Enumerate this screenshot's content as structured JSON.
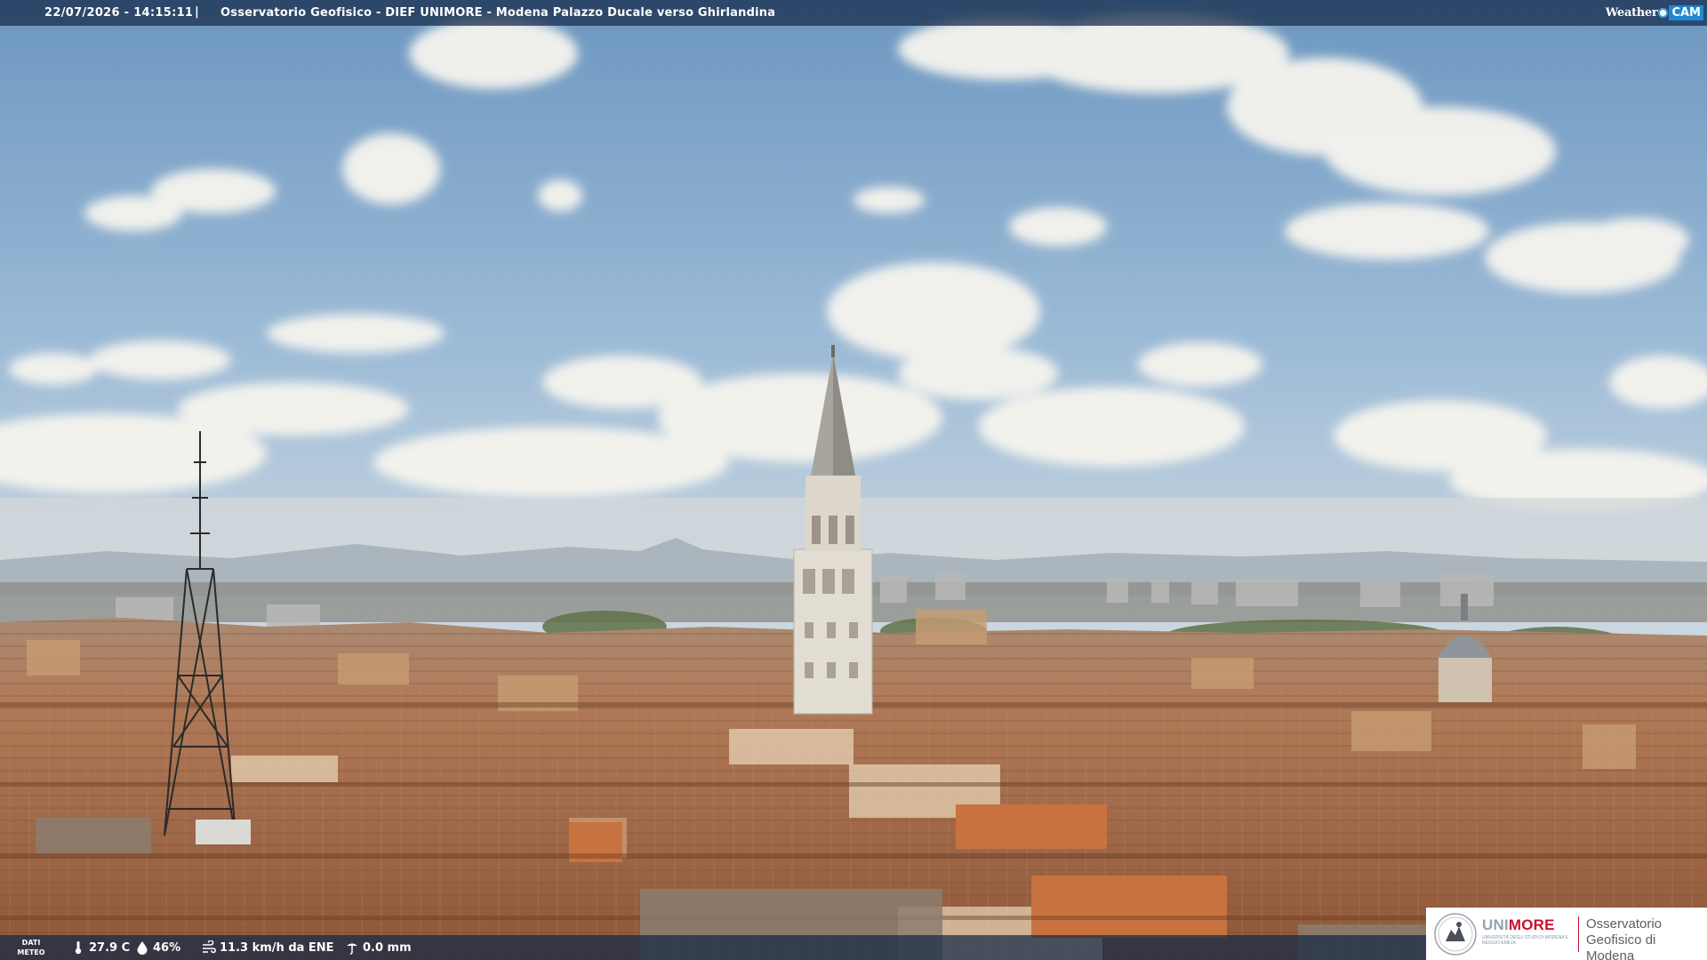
{
  "top_bar": {
    "timestamp": "22/07/2026 - 14:15:11",
    "separator": "|",
    "camera_title": "Osservatorio Geofisico - DIEF UNIMORE - Modena Palazzo Ducale verso Ghirlandina"
  },
  "logo": {
    "weather": "Weather",
    "cam": "CAM"
  },
  "meteo": {
    "label_line1": "DATI",
    "label_line2": "METEO",
    "temperature": "27.9 C",
    "humidity": "46%",
    "wind": "11.3 km/h da ENE",
    "rain": "0.0 mm"
  },
  "institution": {
    "uni": "UNI",
    "more": "MORE",
    "subtitle": "Università degli Studi di Modena e Reggio Emilia",
    "observatory": "Osservatorio Geofisico di Modena"
  },
  "icons": {
    "temperature": "thermometer-icon",
    "humidity": "droplet-icon",
    "wind": "wind-icon",
    "rain": "rain-gauge-icon"
  },
  "colors": {
    "bar_background": "#142846",
    "unimore_red": "#c8102e",
    "weathercam_blue": "#1e88d4"
  }
}
